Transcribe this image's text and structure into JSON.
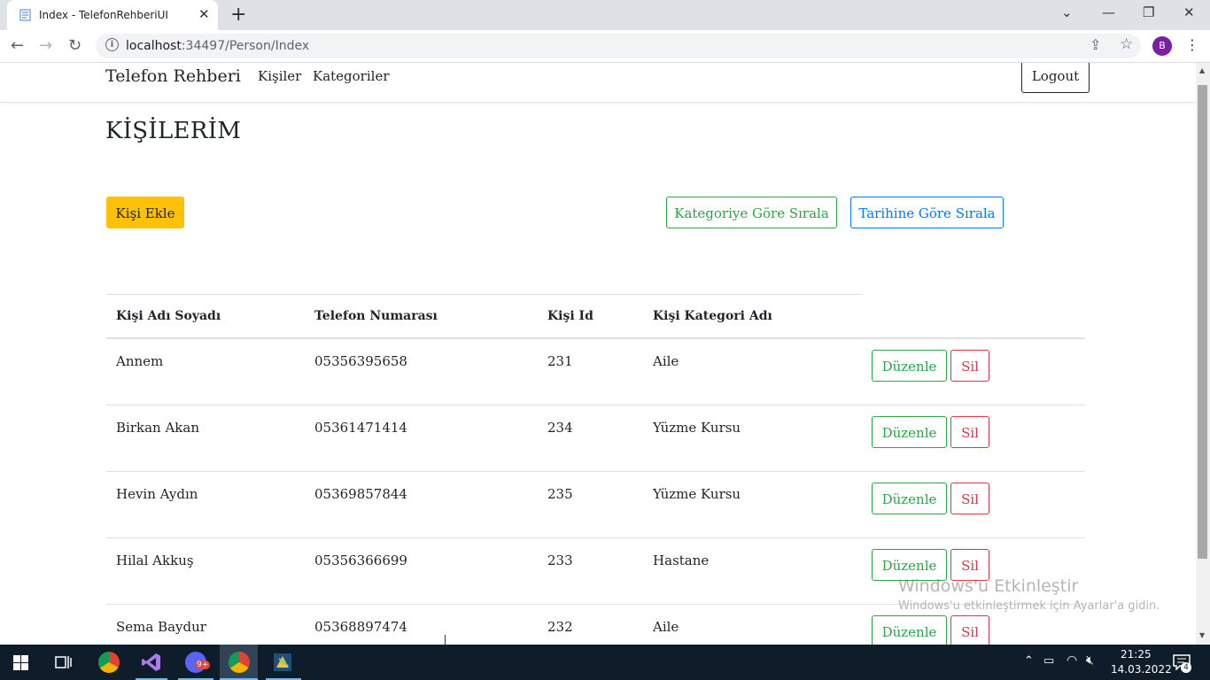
{
  "browser": {
    "tab_title": "Index - TelefonRehberiUI",
    "url_host": "localhost",
    "url_rest": ":34497/Person/Index",
    "avatar_letter": "B"
  },
  "nav": {
    "brand": "Telefon Rehberi",
    "links": [
      "Kişiler",
      "Kategoriler"
    ],
    "logout": "Logout"
  },
  "page": {
    "title": "KİŞİLERİM",
    "add_button": "Kişi Ekle",
    "sort_category_button": "Kategoriye Göre Sırala",
    "sort_date_button": "Tarihine Göre Sırala"
  },
  "table": {
    "headers": [
      "Kişi Adı Soyadı",
      "Telefon Numarası",
      "Kişi Id",
      "Kişi Kategori Adı"
    ],
    "rows": [
      {
        "name": "Annem",
        "phone": "05356395658",
        "id": "231",
        "category": "Aile"
      },
      {
        "name": "Birkan Akan",
        "phone": "05361471414",
        "id": "234",
        "category": "Yüzme Kursu"
      },
      {
        "name": "Hevin Aydın",
        "phone": "05369857844",
        "id": "235",
        "category": "Yüzme Kursu"
      },
      {
        "name": "Hilal Akkuş",
        "phone": "05356366699",
        "id": "233",
        "category": "Hastane"
      },
      {
        "name": "Sema Baydur",
        "phone": "05368897474",
        "id": "232",
        "category": "Aile"
      }
    ],
    "edit_label": "Düzenle",
    "delete_label": "Sil"
  },
  "watermark": {
    "line1": "Windows'u Etkinleştir",
    "line2": "Windows'u etkinleştirmek için Ayarlar'a gidin."
  },
  "taskbar": {
    "time": "21:25",
    "date": "14.03.2022",
    "notification_count": "4",
    "discord_badge": "9+"
  },
  "colors": {
    "warning": "#ffc107",
    "success": "#28a745",
    "primary": "#007bff",
    "danger": "#dc3545"
  }
}
